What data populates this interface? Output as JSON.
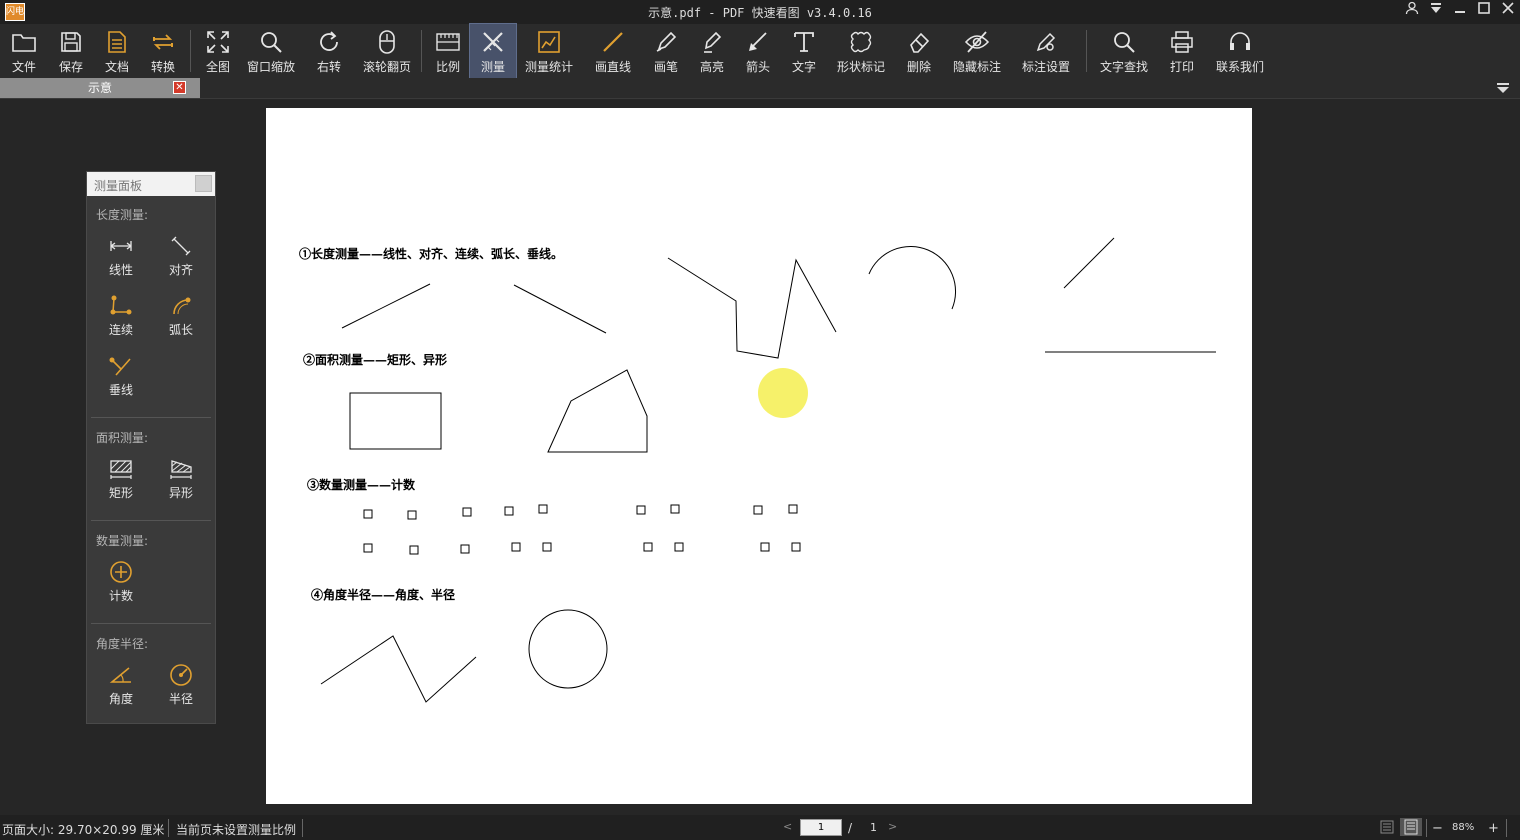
{
  "window": {
    "title": "示意.pdf - PDF 快速看图 v3.4.0.16",
    "logo_text": "闪电"
  },
  "toolbar": [
    {
      "id": "file",
      "label": "文件",
      "icon": "folder-icon"
    },
    {
      "id": "save",
      "label": "保存",
      "icon": "save-icon"
    },
    {
      "id": "doc",
      "label": "文档",
      "icon": "document-icon"
    },
    {
      "id": "convert",
      "label": "转换",
      "icon": "convert-icon"
    },
    {
      "id": "fullview",
      "label": "全图",
      "icon": "fullscreen-icon"
    },
    {
      "id": "window-zoom",
      "label": "窗口缩放",
      "icon": "zoom-icon"
    },
    {
      "id": "rotate",
      "label": "右转",
      "icon": "rotate-icon"
    },
    {
      "id": "wheel-page",
      "label": "滚轮翻页",
      "icon": "mouse-icon"
    },
    {
      "id": "scale",
      "label": "比例",
      "icon": "ruler-icon"
    },
    {
      "id": "measure",
      "label": "测量",
      "icon": "measure-icon",
      "active": true
    },
    {
      "id": "measure-stats",
      "label": "测量统计",
      "icon": "stats-icon"
    },
    {
      "id": "draw-line",
      "label": "画直线",
      "icon": "line-icon"
    },
    {
      "id": "pen",
      "label": "画笔",
      "icon": "pen-icon"
    },
    {
      "id": "highlight",
      "label": "高亮",
      "icon": "highlighter-icon"
    },
    {
      "id": "arrow",
      "label": "箭头",
      "icon": "arrow-icon"
    },
    {
      "id": "text",
      "label": "文字",
      "icon": "text-icon"
    },
    {
      "id": "shape-mark",
      "label": "形状标记",
      "icon": "cloud-shape-icon"
    },
    {
      "id": "delete",
      "label": "删除",
      "icon": "eraser-icon"
    },
    {
      "id": "hide-marks",
      "label": "隐藏标注",
      "icon": "eye-off-icon"
    },
    {
      "id": "mark-settings",
      "label": "标注设置",
      "icon": "settings-pen-icon"
    },
    {
      "id": "find-text",
      "label": "文字查找",
      "icon": "search-icon"
    },
    {
      "id": "print",
      "label": "打印",
      "icon": "printer-icon"
    },
    {
      "id": "contact",
      "label": "联系我们",
      "icon": "headset-icon"
    }
  ],
  "tab": {
    "label": "示意",
    "close": "✕"
  },
  "panel": {
    "title": "测量面板",
    "sections": [
      {
        "title": "长度测量:",
        "items": [
          {
            "label": "线性",
            "icon": "linear-measure-icon"
          },
          {
            "label": "对齐",
            "icon": "aligned-measure-icon"
          },
          {
            "label": "连续",
            "icon": "continuous-measure-icon"
          },
          {
            "label": "弧长",
            "icon": "arc-length-icon"
          },
          {
            "label": "垂线",
            "icon": "perpendicular-icon"
          }
        ]
      },
      {
        "title": "面积测量:",
        "items": [
          {
            "label": "矩形",
            "icon": "rect-area-icon"
          },
          {
            "label": "异形",
            "icon": "irregular-area-icon"
          }
        ]
      },
      {
        "title": "数量测量:",
        "items": [
          {
            "label": "计数",
            "icon": "count-icon"
          }
        ]
      },
      {
        "title": "角度半径:",
        "items": [
          {
            "label": "角度",
            "icon": "angle-icon"
          },
          {
            "label": "半径",
            "icon": "radius-icon"
          }
        ]
      }
    ]
  },
  "document": {
    "captions": [
      "①长度测量——线性、对齐、连续、弧长、垂线。",
      "②面积测量——矩形、异形",
      "③数量测量——计数",
      "④角度半径——角度、半径"
    ]
  },
  "status": {
    "page_size": "页面大小: 29.70×20.99 厘米",
    "scale_note": "当前页未设置测量比例",
    "current_page": "1",
    "page_sep": "/",
    "total_pages": "1",
    "zoom": "88%",
    "zoom_minus": "−",
    "zoom_plus": "+"
  },
  "colors": {
    "accent": "#e0a030",
    "active_tool": "#48526a",
    "cursor": "#f5ef5a"
  }
}
